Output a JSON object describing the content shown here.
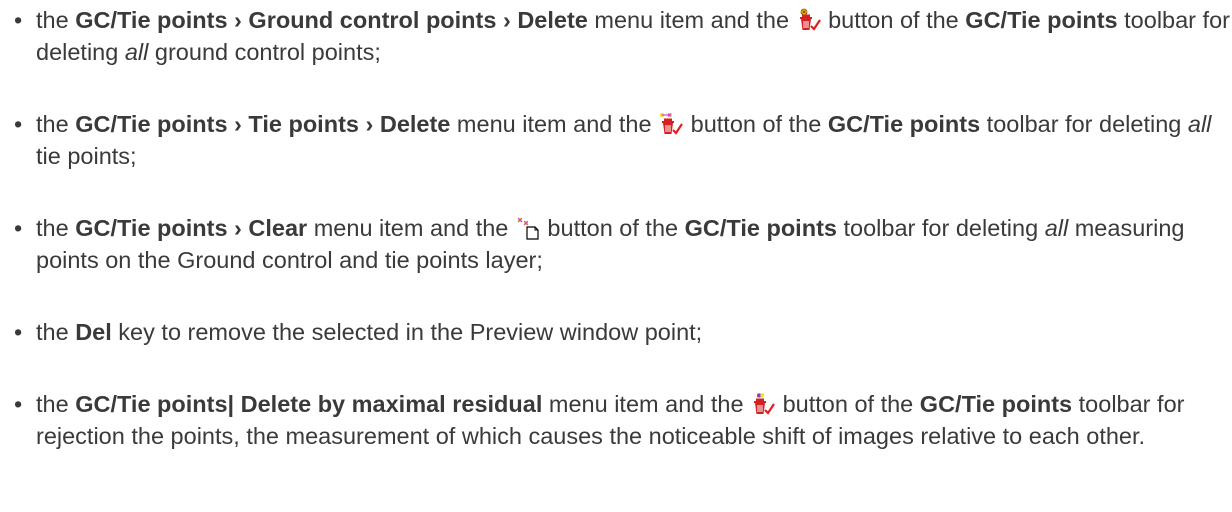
{
  "items": [
    {
      "p1": "the ",
      "menu": "GC/Tie points › Ground control points › Delete",
      "p2": " menu item and the ",
      "icon": "delete-gcp-icon",
      "p3": " button of the ",
      "toolbar": "GC/Tie points",
      "p4": " toolbar for deleting ",
      "em": "all",
      "p5": " ground control points;"
    },
    {
      "p1": "the ",
      "menu": "GC/Tie points › Tie points › Delete",
      "p2": " menu item and the ",
      "icon": "delete-tie-points-icon",
      "p3": " button of the ",
      "toolbar": "GC/Tie points",
      "p4": " toolbar for deleting ",
      "em": "all",
      "p5": " tie points;"
    },
    {
      "p1": "the ",
      "menu": "GC/Tie points › Clear",
      "p2": " menu item and the ",
      "icon": "clear-points-icon",
      "p3": " button of the ",
      "toolbar": "GC/Tie points",
      "p4": " toolbar for deleting ",
      "em": "all",
      "p5": " measuring points on the Ground control and tie points layer;"
    },
    {
      "p1": "the ",
      "key": "Del",
      "p2": " key to remove the selected in the Preview window point;"
    },
    {
      "p1": "the ",
      "menu": "GC/Tie points| Delete by maximal residual",
      "p2": " menu item and the ",
      "icon": "delete-by-residual-icon",
      "p3": " button of the ",
      "toolbar": "GC/Tie points",
      "p4": " toolbar for rejection the points, the measurement of which causes the noticeable shift of images relative to each other."
    }
  ],
  "colors": {
    "text": "#3a3a3a",
    "trash_red": "#d42020",
    "check_red": "#e02020",
    "marker_yellow": "#e8e000",
    "marker_magenta": "#d040d0"
  }
}
